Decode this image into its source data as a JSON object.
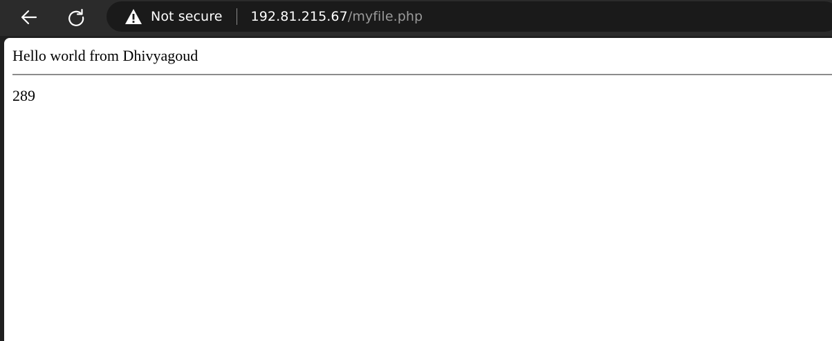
{
  "toolbar": {
    "icons": {
      "back": "arrow-left-icon",
      "reload": "reload-icon",
      "security": "warning-triangle-icon"
    },
    "security_label": "Not secure",
    "url_host": "192.81.215.67",
    "url_path": "/myfile.php"
  },
  "page": {
    "greeting": "Hello world from Dhivyagoud",
    "number": "289"
  },
  "colors": {
    "toolbar_bg": "#2b2b2b",
    "omnibox_bg": "#1a1a1a",
    "url_host": "#ffffff",
    "url_path": "#9a9a9a",
    "page_bg": "#ffffff",
    "rule": "#8c8c8c"
  }
}
